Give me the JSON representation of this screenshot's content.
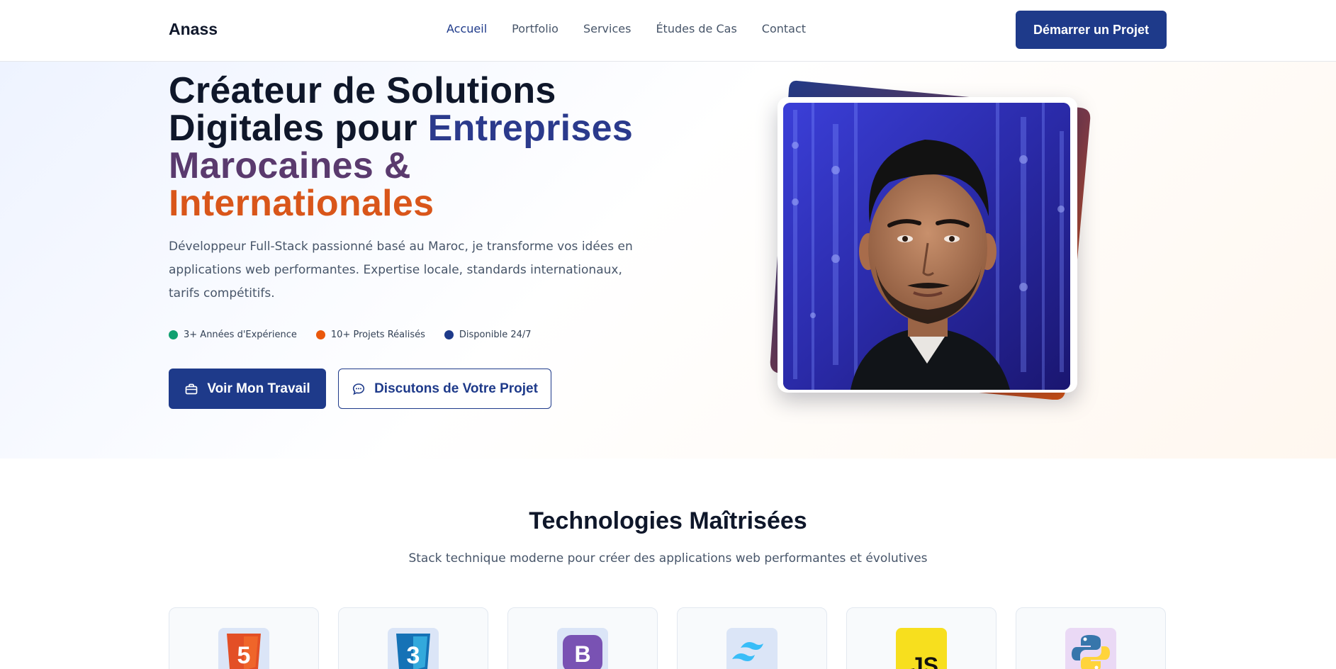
{
  "nav": {
    "brand": "Anass",
    "links": [
      "Accueil",
      "Portfolio",
      "Services",
      "Études de Cas",
      "Contact"
    ],
    "cta": "Démarrer un Projet"
  },
  "hero": {
    "title_plain": "Créateur de Solutions Digitales pour ",
    "title_hl1": "Entreprises",
    "title_hl2": "Marocaines &",
    "title_hl3": "Internationales",
    "subtitle": "Développeur Full-Stack passionné basé au Maroc, je transforme vos idées en applications web performantes. Expertise locale, standards internationaux, tarifs compétitifs.",
    "stats": [
      {
        "label": "3+ Années d'Expérience",
        "color": "#10a070"
      },
      {
        "label": "10+ Projets Réalisés",
        "color": "#ea580c"
      },
      {
        "label": "Disponible 24/7",
        "color": "#1e3a8a"
      }
    ],
    "primary_button": "Voir Mon Travail",
    "secondary_button": "Discutons de Votre Projet"
  },
  "tech": {
    "title": "Technologies Maîtrisées",
    "subtitle": "Stack technique moderne pour créer des applications web performantes et évolutives",
    "items": [
      {
        "icon": "html5-icon",
        "bg": "#dbe5f7"
      },
      {
        "icon": "css3-icon",
        "bg": "#dbe5f7"
      },
      {
        "icon": "bootstrap-icon",
        "bg": "#dbe5f7"
      },
      {
        "icon": "tailwind-icon",
        "bg": "#dbe5f7"
      },
      {
        "icon": "javascript-icon",
        "bg": "#f7df1e"
      },
      {
        "icon": "python-icon",
        "bg": "#ead9f5"
      }
    ]
  },
  "colors": {
    "primary": "#1e3a8a",
    "accent": "#ea580c"
  }
}
